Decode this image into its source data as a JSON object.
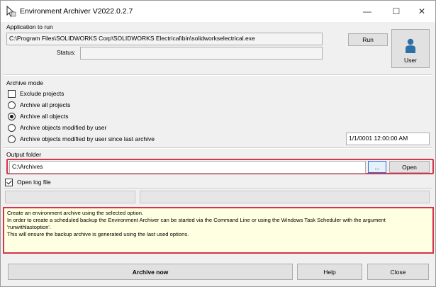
{
  "window": {
    "title": "Environment Archiver V2022.0.2.7",
    "minimize_glyph": "—",
    "maximize_glyph": "☐",
    "close_glyph": "✕"
  },
  "app_to_run": {
    "group_label": "Application to run",
    "path": "C:\\Program Files\\SOLIDWORKS Corp\\SOLIDWORKS Electrical\\bin\\solidworkselectrical.exe",
    "run_label": "Run",
    "status_label": "Status:",
    "status_value": "",
    "user_label": "User"
  },
  "archive_mode": {
    "group_label": "Archive mode",
    "exclude_projects": {
      "label": "Exclude projects",
      "checked": false
    },
    "options": [
      {
        "label": "Archive all projects",
        "selected": false
      },
      {
        "label": "Archive all objects",
        "selected": true
      },
      {
        "label": "Archive objects modified by user",
        "selected": false
      },
      {
        "label": "Archive objects modified by user since last archive",
        "selected": false
      }
    ],
    "last_archive_date": "1/1/0001 12:00:00 AM"
  },
  "output_folder": {
    "group_label": "Output folder",
    "path": "C:\\Archives",
    "browse_label": "...",
    "open_label": "Open",
    "open_log": {
      "label": "Open log file",
      "checked": true
    }
  },
  "info": {
    "lines": [
      "Create an environment archive using the selected option.",
      "In order to create a scheduled backup the Environment Archiver can be started via the Command Line or using the Windows Task Scheduler with the argument",
      "'runwithlastoption'.",
      "This will ensure the backup archive is generated using the last used options."
    ]
  },
  "footer": {
    "archive_now_label": "Archive now",
    "help_label": "Help",
    "close_label": "Close"
  },
  "colors": {
    "highlight_frame": "#d9334a",
    "info_background": "#ffffe1",
    "focus_blue": "#2b6fd6"
  }
}
